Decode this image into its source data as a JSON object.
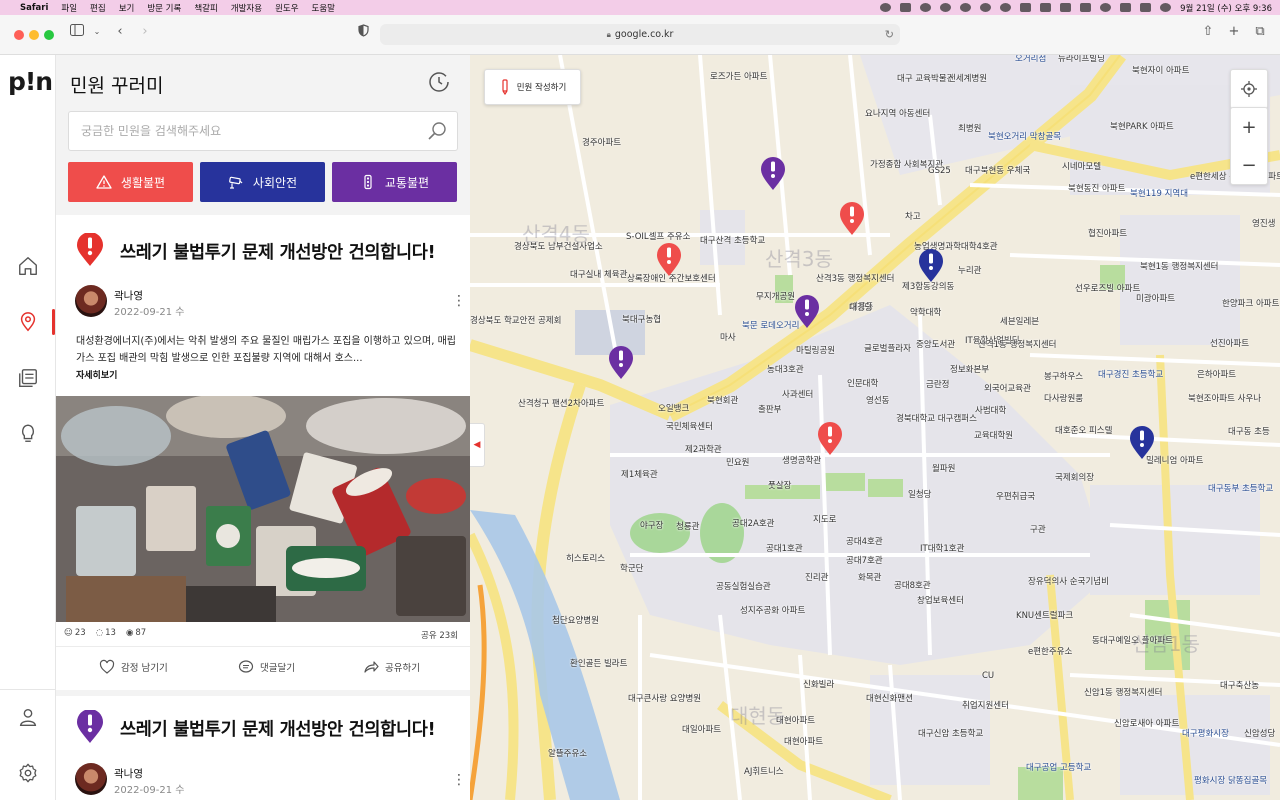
{
  "menubar": {
    "items": [
      "Safari",
      "파일",
      "편집",
      "보기",
      "방문 기록",
      "책갈피",
      "개발자용",
      "윈도우",
      "도움말"
    ],
    "clock": "9월 21일 (수) 오후 9:36"
  },
  "browser": {
    "url": "google.co.kr"
  },
  "app": {
    "logo": "p!n",
    "title": "민원 꾸러미",
    "search_placeholder": "궁금한 민원을 검색해주세요",
    "categories": [
      {
        "label": "생활불편",
        "color": "#ef4d4b"
      },
      {
        "label": "사회안전",
        "color": "#27339c"
      },
      {
        "label": "교통불편",
        "color": "#6b2fa2"
      }
    ]
  },
  "posts": [
    {
      "title": "쓰레기 불법투기 문제 개선방안 건의합니다!",
      "author": "곽나영",
      "date": "2022-09-21 수",
      "excerpt": "대성환경에너지(주)에서는 악취 발생의 주요 물질인 매립가스 포집을 이행하고 있으며, 매립가스 포집 배관의 막힘 발생으로 인한 포집불량 지역에 대해서 호스...",
      "more": "자세히보기",
      "stats": {
        "reactions": "23",
        "comments": "13",
        "views": "87"
      },
      "share": "공유 23회",
      "actions": {
        "react": "감정 남기기",
        "comment": "댓글달기",
        "share": "공유하기"
      },
      "badge_color": "#e5322d"
    },
    {
      "title": "쓰레기 불법투기 문제 개선방안 건의합니다!",
      "author": "곽나영",
      "date": "2022-09-21 수",
      "badge_color": "#6b2fa2"
    }
  ],
  "map": {
    "write_button": "민원 작성하기",
    "labels": [
      "오거리점",
      "뉴라이프빌딩",
      "로즈가든 아파트",
      "대구 교육박물관",
      "신세계병원",
      "북현자이 아파트",
      "요나지역 아동센터",
      "최병원",
      "북현오거리 막창골목",
      "북현PARK 아파트",
      "경주아파트",
      "가정종합 사회복지관",
      "GS25",
      "대구북현동 우체국",
      "시네마모텔",
      "e편한세상 북현다우아파트",
      "북현동진 아파트",
      "북현119 지역대",
      "영진생",
      "산격4동",
      "차고",
      "협진아파트",
      "S-OIL셀프 주유소",
      "대구산격 초등학교",
      "경상북도 남부건설사업소",
      "산격3동",
      "농업생명과학대학4호관",
      "상록장애인 주간보호센터",
      "대구실내 체육관",
      "산격3동 행정복지센터",
      "누리관",
      "북현1동 행정복지센터",
      "무지개공원",
      "제3합동강의동",
      "대륭동",
      "선우로즈빌 아파트",
      "미광아파트",
      "한양파크 아파트",
      "북대구농협",
      "대경당",
      "약학대학",
      "세븐일레븐",
      "경상북도 학교안전 공제회",
      "마사",
      "북문 로데오거리",
      "중앙도서관",
      "IT융합산업빌딩",
      "산격1동 행정복지센터",
      "글로벌플라자",
      "마틸링공원",
      "선진아파트",
      "농대3호관",
      "정보화본부",
      "대구경진 초등학교",
      "봉구하우스",
      "인문대학",
      "금란정",
      "외국어교육관",
      "은하아파트",
      "사과센터",
      "북현회관",
      "다사랑원룸",
      "북현조아파트 사우나",
      "산격청구 팬션2차아파트",
      "오일뱅크",
      "출판부",
      "영선동",
      "사범대학",
      "경북대학교 대구캠퍼스",
      "국민체육센터",
      "교육대학원",
      "대호준오 피스텔",
      "대구동 초등",
      "제2과학관",
      "생명공학관",
      "제1체육관",
      "민요원",
      "월파원",
      "국제회의장",
      "밀레니엄 아파트",
      "풋살장",
      "일청당",
      "우편취급국",
      "대구동부 초등학교",
      "야구장",
      "청룡관",
      "공대2A호관",
      "지도로",
      "구관",
      "공대1호관",
      "공대4호관",
      "IT대학1호관",
      "히스토리스",
      "공대7호관",
      "학군단",
      "진리관",
      "화목관",
      "공동실험실습관",
      "공대8호관",
      "장유덕의사 순국기념비",
      "첨단요양병원",
      "성지주공화 아파트",
      "창업보육센터",
      "KNU센트럴파크",
      "동대구예일오 플아파트",
      "환인골든 빌라트",
      "e편한주유소",
      "CU",
      "대구축산농",
      "대구큰사랑 요양병원",
      "신화빌라",
      "대현신화맨션",
      "신암1동 행정복지센터",
      "대현아파트",
      "취업지원센터",
      "신암로새아 아파트",
      "대일아파트",
      "대현아파트",
      "대구신암 초등학교",
      "대구평화시장",
      "신암성당",
      "알뜰주유소",
      "AJ휘트니스",
      "대구공업 고등학교",
      "평화시장 닭똥집골목",
      "대현동",
      "신암1동"
    ]
  }
}
